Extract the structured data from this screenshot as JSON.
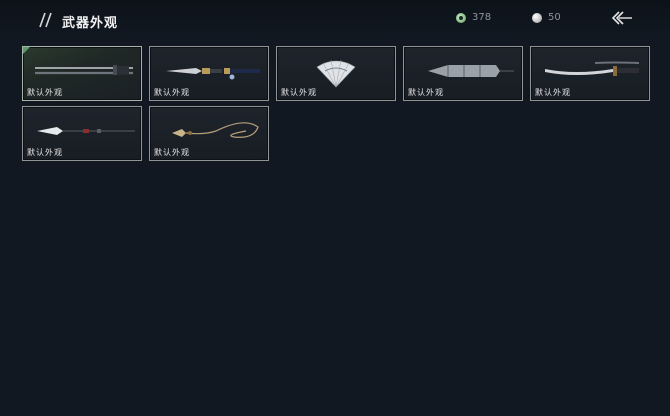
{
  "header": {
    "title": "武器外观"
  },
  "currency": {
    "jade": {
      "icon": "jade-coin-icon",
      "amount": "378"
    },
    "pearl": {
      "icon": "pearl-icon",
      "amount": "50"
    }
  },
  "back": {
    "icon": "back-arrow-icon"
  },
  "weapons": [
    {
      "label": "默认外观",
      "icon": "sword-icon",
      "selected": true
    },
    {
      "label": "默认外观",
      "icon": "dual-blades-icon",
      "selected": false
    },
    {
      "label": "默认外观",
      "icon": "fan-icon",
      "selected": false
    },
    {
      "label": "默认外观",
      "icon": "umbrella-icon",
      "selected": false
    },
    {
      "label": "默认外观",
      "icon": "saber-icon",
      "selected": false
    },
    {
      "label": "默认外观",
      "icon": "spear-icon",
      "selected": false
    },
    {
      "label": "默认外观",
      "icon": "rope-dart-icon",
      "selected": false
    }
  ]
}
